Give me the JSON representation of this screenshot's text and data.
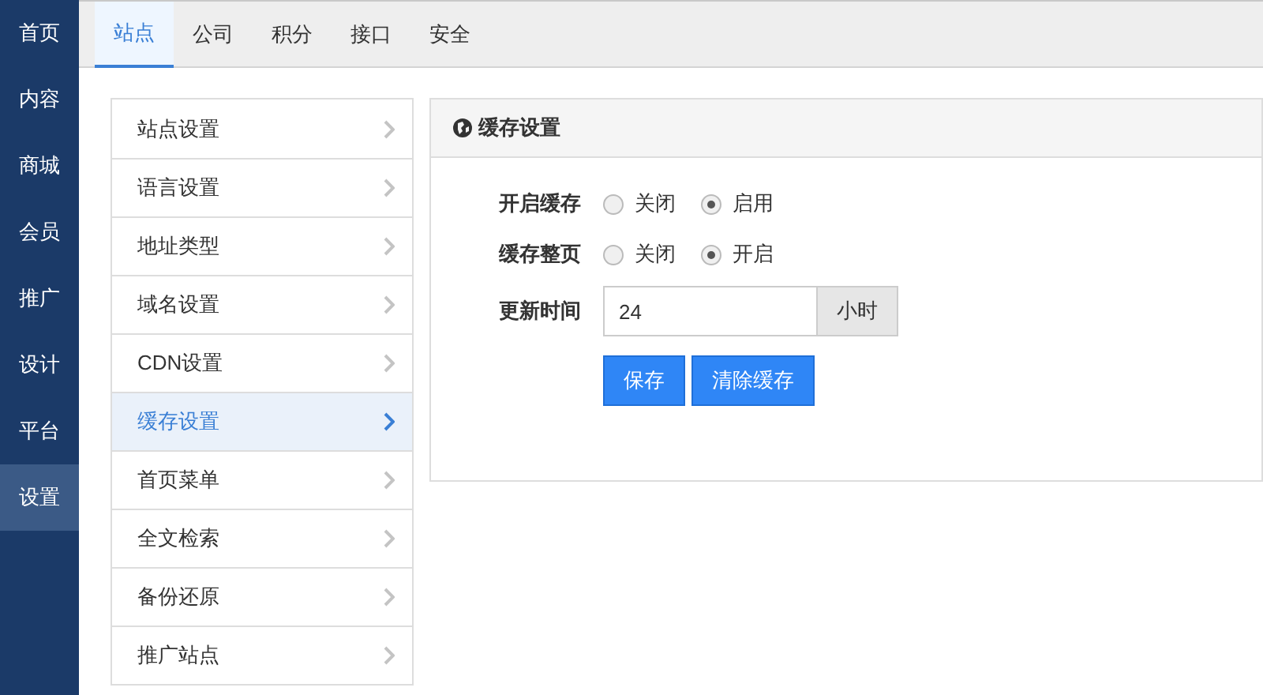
{
  "sidebar": {
    "items": [
      {
        "label": "首页",
        "selected": false
      },
      {
        "label": "内容",
        "selected": false
      },
      {
        "label": "商城",
        "selected": false
      },
      {
        "label": "会员",
        "selected": false
      },
      {
        "label": "推广",
        "selected": false
      },
      {
        "label": "设计",
        "selected": false
      },
      {
        "label": "平台",
        "selected": false
      },
      {
        "label": "设置",
        "selected": true
      }
    ]
  },
  "tabs": [
    {
      "label": "站点",
      "selected": true
    },
    {
      "label": "公司",
      "selected": false
    },
    {
      "label": "积分",
      "selected": false
    },
    {
      "label": "接口",
      "selected": false
    },
    {
      "label": "安全",
      "selected": false
    }
  ],
  "menu": {
    "items": [
      {
        "label": "站点设置",
        "selected": false
      },
      {
        "label": "语言设置",
        "selected": false
      },
      {
        "label": "地址类型",
        "selected": false
      },
      {
        "label": "域名设置",
        "selected": false
      },
      {
        "label": "CDN设置",
        "selected": false
      },
      {
        "label": "缓存设置",
        "selected": true
      },
      {
        "label": "首页菜单",
        "selected": false
      },
      {
        "label": "全文检索",
        "selected": false
      },
      {
        "label": "备份还原",
        "selected": false
      },
      {
        "label": "推广站点",
        "selected": false
      }
    ]
  },
  "panel": {
    "title": "缓存设置",
    "fields": [
      {
        "kind": "radio",
        "label": "开启缓存",
        "options": [
          {
            "label": "关闭",
            "selected": false
          },
          {
            "label": "启用",
            "selected": true
          }
        ]
      },
      {
        "kind": "radio",
        "label": "缓存整页",
        "options": [
          {
            "label": "关闭",
            "selected": false
          },
          {
            "label": "开启",
            "selected": true
          }
        ]
      },
      {
        "kind": "input",
        "label": "更新时间",
        "value": "24",
        "addon": "小时"
      }
    ],
    "buttons": [
      "保存",
      "清除缓存"
    ]
  }
}
